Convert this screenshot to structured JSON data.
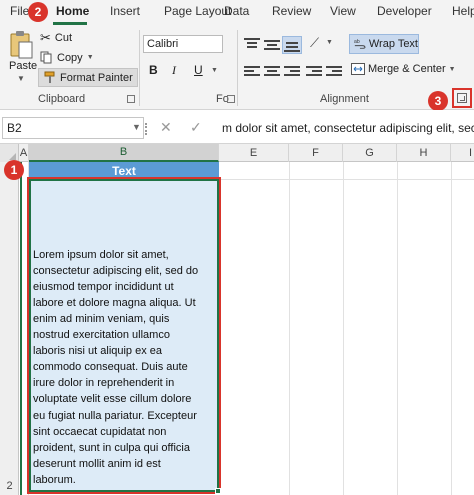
{
  "ribbon": {
    "tabs": [
      "File",
      "Home",
      "Insert",
      "Page Layout",
      "Data",
      "Review",
      "View",
      "Developer",
      "Help"
    ],
    "active_tab": "Home",
    "clipboard": {
      "paste_label": "Paste",
      "cut_label": "Cut",
      "copy_label": "Copy",
      "format_painter_label": "Format Painter",
      "group_label": "Clipboard"
    },
    "font": {
      "font_name": "Calibri",
      "bold": "B",
      "italic": "I",
      "underline": "U",
      "group_label": "Fo"
    },
    "alignment": {
      "wrap_text_label": "Wrap Text",
      "merge_center_label": "Merge & Center",
      "group_label": "Alignment"
    }
  },
  "badges": {
    "one": "1",
    "two": "2",
    "three": "3"
  },
  "formula_bar": {
    "name_box": "B2",
    "cancel": "✕",
    "enter": "✓",
    "content": "m dolor sit amet, consectetur adipiscing elit, sec"
  },
  "grid": {
    "columns": [
      "A",
      "B",
      "E",
      "F",
      "G",
      "H",
      "I"
    ],
    "rows": [
      "1",
      "2"
    ],
    "b1_value": "Text",
    "b2_value": "Lorem ipsum dolor sit amet,\nconsectetur adipiscing elit, sed do\neiusmod tempor incididunt ut\nlabore et dolore magna aliqua. Ut\nenim ad minim veniam, quis\nnostrud exercitation ullamco\nlaboris nisi ut aliquip ex ea\ncommodo consequat. Duis aute\nirure dolor in reprehenderit in\nvoluptate velit esse cillum dolore\neu fugiat nulla pariatur. Excepteur\nsint occaecat cupidatat non\nproident, sunt in culpa qui officia\ndeserunt mollit anim id est\nlaborum."
  },
  "colors": {
    "accent": "#217346",
    "header_fill": "#5b9bd5",
    "cell_fill": "#ddebf7",
    "badge": "#d9342b"
  }
}
